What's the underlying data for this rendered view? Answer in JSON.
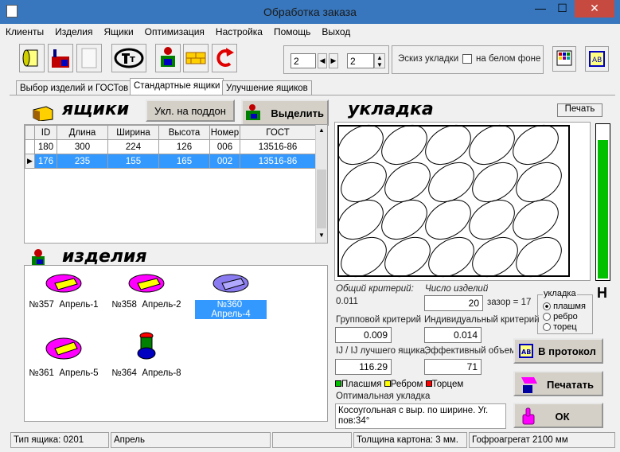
{
  "window": {
    "title": "Обработка заказа",
    "min": "—",
    "max": "☐",
    "close": "✕"
  },
  "menu": [
    "Клиенты",
    "Изделия",
    "Ящики",
    "Оптимизация",
    "Настройка",
    "Помощь",
    "Выход"
  ],
  "toolbar": {
    "spin1": "2",
    "spin2": "2",
    "sketch_label": "Эскиз укладки",
    "white_bg_label": "на белом фоне"
  },
  "tabs": [
    "Выбор изделий и ГОСТов",
    "Стандартные ящики",
    "Улучшение ящиков"
  ],
  "boxes": {
    "title": "ящики",
    "btn_pallet": "Укл. на поддон",
    "btn_select": "Выделить",
    "columns": [
      "ID",
      "Длина",
      "Ширина",
      "Высота",
      "Номер",
      "ГОСТ"
    ],
    "rows": [
      [
        "180",
        "300",
        "224",
        "126",
        "006",
        "13516-86"
      ],
      [
        "176",
        "235",
        "155",
        "165",
        "002",
        "13516-86"
      ]
    ]
  },
  "products": {
    "title": "изделия",
    "items": [
      {
        "num": "№357",
        "name": "Апрель-1",
        "color": "#ff00ff"
      },
      {
        "num": "№358",
        "name": "Апрель-2",
        "color": "#ff00ff"
      },
      {
        "num": "№360",
        "name": "Апрель-4",
        "color": "#8a7cf0"
      },
      {
        "num": "№361",
        "name": "Апрель-5",
        "color": "#ff00ff"
      },
      {
        "num": "№364",
        "name": "Апрель-8",
        "color": "#ff0000"
      }
    ]
  },
  "layout": {
    "title": "укладка",
    "print_btn": "Печать",
    "gauge_label": "Н",
    "total_crit_label": "Общий критерий:",
    "total_crit": "0.011",
    "count_label": "Число изделий",
    "count": "20",
    "gap": "зазор = 17",
    "group_crit_label": "Групповой критерий",
    "group_crit": "0.009",
    "indiv_crit_label": "Индивидуальный критерий",
    "indiv_crit": "0.014",
    "ratio_label": "IJ / IJ лучшего ящика,",
    "ratio": "116.29",
    "eff_label": "Эффективный объем",
    "eff": "71",
    "legend": [
      "Пласшмя",
      "Ребром",
      "Торцем"
    ],
    "legend_colors": [
      "#00c000",
      "#ffff00",
      "#ff0000"
    ],
    "optimal_label": "Оптимальная укладка",
    "optimal_text": "Косоугольная с выр. по ширине. Уг. пов:34°",
    "orient_group": "укладка",
    "orient": [
      "плашмя",
      "ребро",
      "торец"
    ]
  },
  "actions": {
    "protocol": "В протокол",
    "print": "Печатать",
    "ok": "ОК"
  },
  "status": [
    "Тип ящика: 0201",
    "Апрель",
    "",
    "Толщина картона: 3 мм.",
    "Гофроагрегат 2100 мм"
  ]
}
